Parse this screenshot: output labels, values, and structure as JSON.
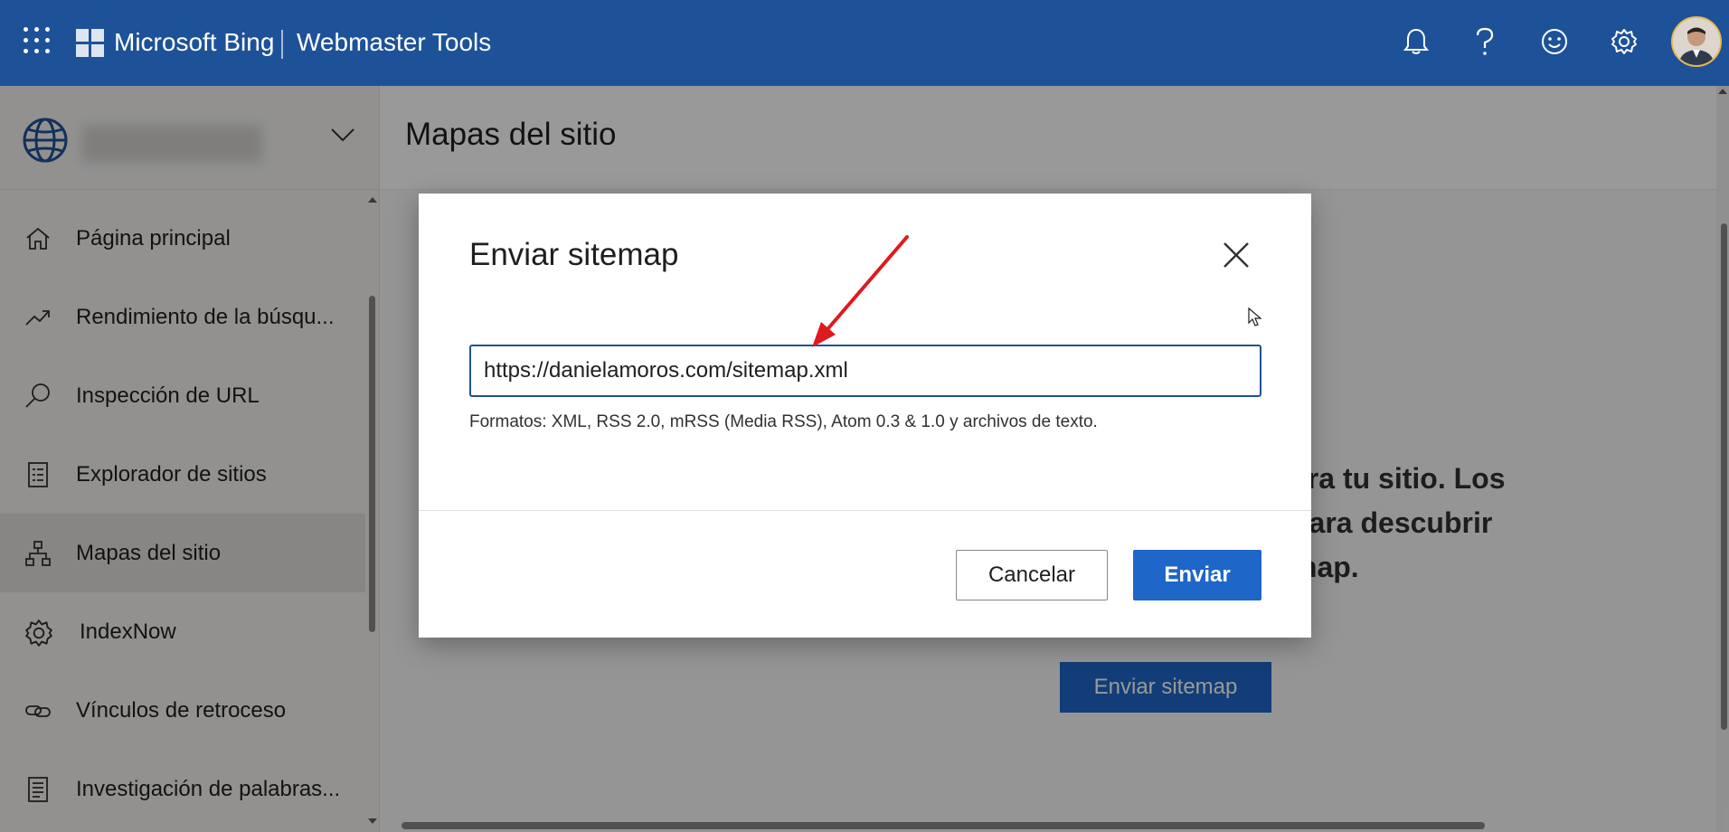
{
  "header": {
    "brand": "Microsoft Bing",
    "product": "Webmaster Tools",
    "icons": [
      "apps-grid-icon",
      "microsoft-logo-icon",
      "bell-icon",
      "help-icon",
      "feedback-smiley-icon",
      "settings-gear-icon",
      "user-avatar"
    ]
  },
  "sidebar": {
    "site_selector_icon": "globe-icon",
    "items": [
      {
        "label": "Página principal",
        "icon": "home-icon"
      },
      {
        "label": "Rendimiento de la búsqu...",
        "icon": "trend-icon"
      },
      {
        "label": "Inspección de URL",
        "icon": "search-icon"
      },
      {
        "label": "Explorador de sitios",
        "icon": "document-list-icon"
      },
      {
        "label": "Mapas del sitio",
        "icon": "sitemap-icon",
        "active": true
      },
      {
        "label": "IndexNow",
        "icon": "gear-icon"
      },
      {
        "label": "Vínculos de retroceso",
        "icon": "link-icon"
      },
      {
        "label": "Investigación de palabras...",
        "icon": "document-icon"
      }
    ]
  },
  "main": {
    "title": "Mapas del sitio",
    "hero_lines": [
      "ara tu sitio. Los",
      "para descubrir",
      "map."
    ],
    "cta_label": "Enviar sitemap"
  },
  "dialog": {
    "title": "Enviar sitemap",
    "input_value": "https://danielamoros.com/sitemap.xml",
    "help": "Formatos: XML, RSS 2.0, mRSS (Media RSS), Atom 0.3 & 1.0 y archivos de texto.",
    "cancel_label": "Cancelar",
    "submit_label": "Enviar"
  },
  "colors": {
    "header_bg": "#1e5298",
    "primary": "#1e66c8",
    "annotation_arrow": "#e0191f"
  }
}
